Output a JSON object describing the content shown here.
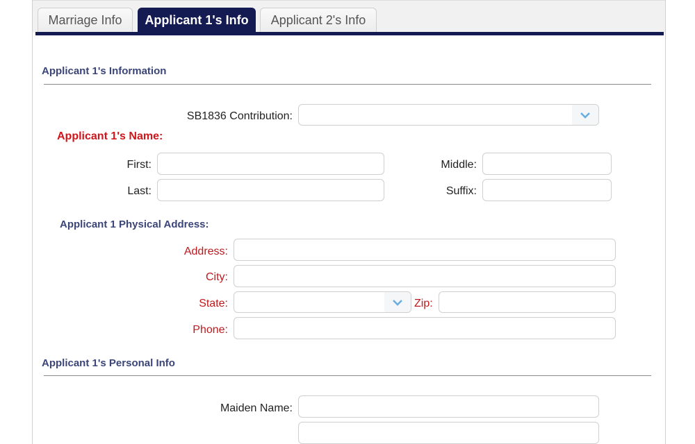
{
  "tabs": [
    {
      "label": "Marriage Info",
      "active": false
    },
    {
      "label": "Applicant 1's Info",
      "active": true
    },
    {
      "label": "Applicant 2's Info",
      "active": false
    }
  ],
  "sections": {
    "information": "Applicant 1's Information",
    "personal": "Applicant 1's Personal Info"
  },
  "contribution": {
    "label": "SB1836 Contribution:",
    "value": ""
  },
  "name": {
    "heading": "Applicant 1's Name:",
    "first_label": "First:",
    "middle_label": "Middle:",
    "last_label": "Last:",
    "suffix_label": "Suffix:"
  },
  "address": {
    "heading": "Applicant 1 Physical Address:",
    "address_label": "Address:",
    "city_label": "City:",
    "state_label": "State:",
    "state_value": "",
    "zip_label": "Zip:",
    "phone_label": "Phone:"
  },
  "personal": {
    "maiden_label": "Maiden Name:"
  },
  "colors": {
    "tab_active": "#141a52",
    "section_title": "#3b4577",
    "required_label": "#c0191d",
    "chevron": "#6aaee0"
  }
}
